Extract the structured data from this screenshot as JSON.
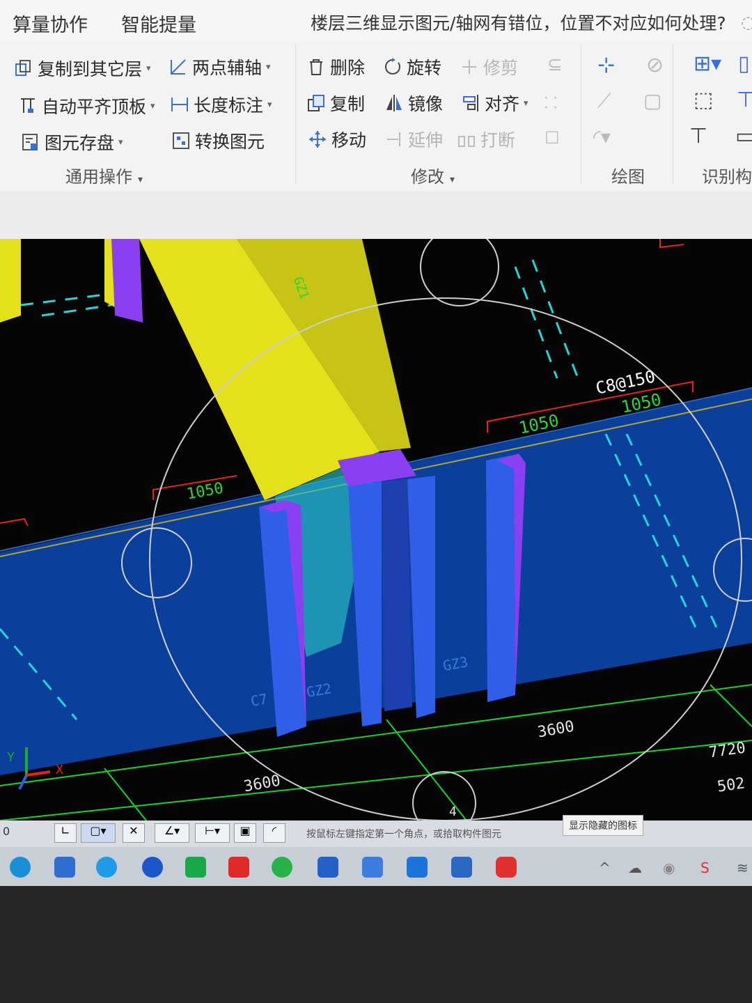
{
  "menu": {
    "items": [
      "算量协作",
      "智能提量"
    ],
    "question": "楼层三维显示图元/轴网有错位，位置不对应如何处理?"
  },
  "ribbon": {
    "general": {
      "label": "通用操作",
      "copy_to_layer": "复制到其它层",
      "auto_align_slab": "自动平齐顶板",
      "save_element": "图元存盘",
      "two_point_axis": "两点辅轴",
      "length_dim": "长度标注",
      "convert_element": "转换图元"
    },
    "modify": {
      "label": "修改",
      "delete": "删除",
      "rotate": "旋转",
      "trim": "修剪",
      "copy": "复制",
      "mirror": "镜像",
      "align": "对齐",
      "move": "移动",
      "extend": "延伸",
      "break": "打断"
    },
    "draw": {
      "label": "绘图"
    },
    "recognize": {
      "label": "识别构"
    }
  },
  "viewport": {
    "rebar_label": "C8@150",
    "dims": [
      "1050",
      "1050",
      "1050",
      "3600",
      "3600",
      "7720",
      "502"
    ],
    "column_labels": [
      "C7",
      "GZ2",
      "GZ3",
      "GZ1"
    ],
    "axis_x": "X",
    "axis_y": "Y",
    "marker": "4",
    "colors": {
      "wall": "#0b3f9c",
      "column_side": "#2f5ee8",
      "column_top": "#8a3ff0",
      "beam": "#e4e01c",
      "axis_line": "#11d62a",
      "dim_red": "#e82020",
      "dim_text": "#29d63a",
      "cyan": "#22d7d7"
    }
  },
  "status": {
    "left_value": "0",
    "hint": "按鼠标左键指定第一个角点，或拾取构件图元",
    "tooltip": "显示隐藏的图标"
  },
  "taskbar": {
    "icons": [
      "edge-icon",
      "store-icon",
      "browser-icon",
      "app-icon",
      "mail-icon",
      "wps-icon",
      "wechat-icon",
      "glodon-icon",
      "docs-icon",
      "upload-icon",
      "tool-icon",
      "netease-icon"
    ]
  }
}
